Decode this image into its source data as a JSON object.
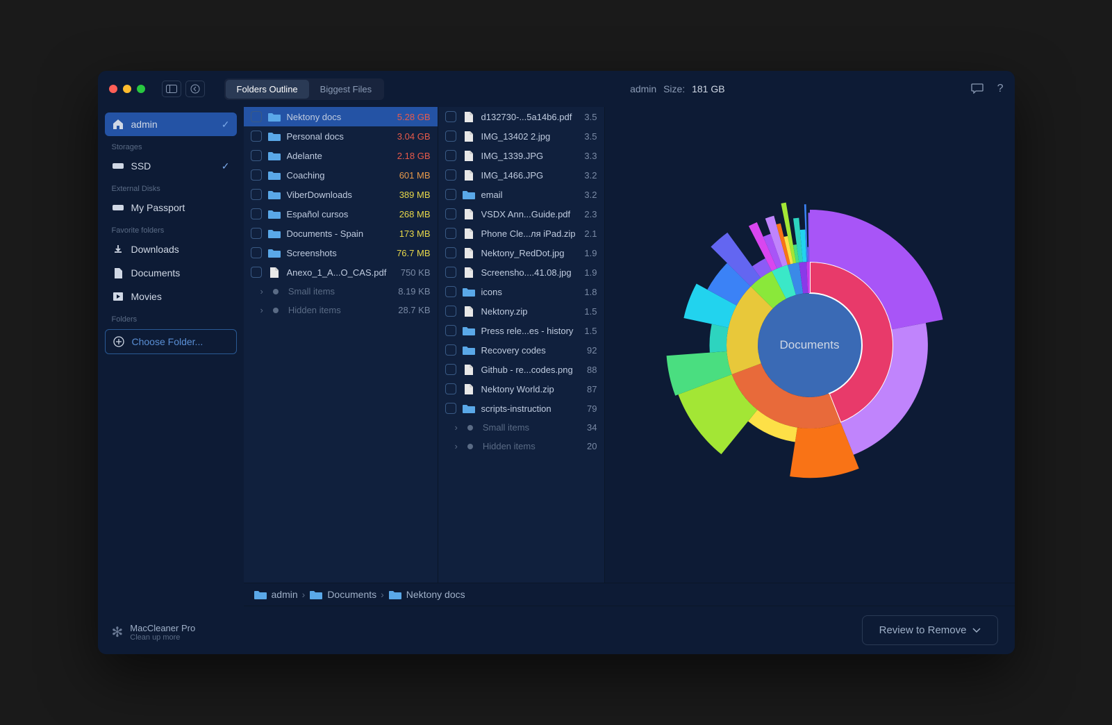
{
  "toolbar": {
    "segments": [
      {
        "label": "Folders Outline",
        "active": true
      },
      {
        "label": "Biggest Files",
        "active": false
      }
    ],
    "title_user": "admin",
    "title_size_label": "Size:",
    "title_size_value": "181 GB"
  },
  "sidebar": {
    "user": {
      "label": "admin",
      "selected": true,
      "checked": true
    },
    "sections": {
      "storages_label": "Storages",
      "storages": [
        {
          "label": "SSD",
          "checked": true
        }
      ],
      "external_label": "External Disks",
      "external": [
        {
          "label": "My Passport"
        }
      ],
      "favorites_label": "Favorite folders",
      "favorites": [
        {
          "label": "Downloads",
          "icon": "download"
        },
        {
          "label": "Documents",
          "icon": "doc"
        },
        {
          "label": "Movies",
          "icon": "movie"
        }
      ],
      "folders_label": "Folders",
      "choose_label": "Choose Folder..."
    },
    "footer": {
      "title": "MacCleaner Pro",
      "sub": "Clean up more"
    }
  },
  "column1": [
    {
      "name": "Nektony docs",
      "size": "5.28 GB",
      "sizeClass": "size-red",
      "type": "folder",
      "selected": true
    },
    {
      "name": "Personal docs",
      "size": "3.04 GB",
      "sizeClass": "size-red",
      "type": "folder"
    },
    {
      "name": "Adelante",
      "size": "2.18 GB",
      "sizeClass": "size-red",
      "type": "folder"
    },
    {
      "name": "Coaching",
      "size": "601 MB",
      "sizeClass": "size-orange",
      "type": "folder"
    },
    {
      "name": "ViberDownloads",
      "size": "389 MB",
      "sizeClass": "size-yellow",
      "type": "folder"
    },
    {
      "name": "Español cursos",
      "size": "268 MB",
      "sizeClass": "size-yellow",
      "type": "folder"
    },
    {
      "name": "Documents - Spain",
      "size": "173 MB",
      "sizeClass": "size-yellow",
      "type": "folder"
    },
    {
      "name": "Screenshots",
      "size": "76.7 MB",
      "sizeClass": "size-yellow",
      "type": "folder"
    },
    {
      "name": "Anexo_1_A...O_CAS.pdf",
      "size": "750 KB",
      "sizeClass": "size-gray",
      "type": "file"
    }
  ],
  "column1_sub": [
    {
      "name": "Small items",
      "size": "8.19 KB"
    },
    {
      "name": "Hidden items",
      "size": "28.7 KB"
    }
  ],
  "column2": [
    {
      "name": "d132730-...5a14b6.pdf",
      "size": "3.5",
      "type": "file"
    },
    {
      "name": "IMG_13402 2.jpg",
      "size": "3.5",
      "type": "file"
    },
    {
      "name": "IMG_1339.JPG",
      "size": "3.3",
      "type": "file"
    },
    {
      "name": "IMG_1466.JPG",
      "size": "3.2",
      "type": "file"
    },
    {
      "name": "email",
      "size": "3.2",
      "type": "folder"
    },
    {
      "name": "VSDX Ann...Guide.pdf",
      "size": "2.3",
      "type": "file"
    },
    {
      "name": "Phone Cle...ля iPad.zip",
      "size": "2.1",
      "type": "file"
    },
    {
      "name": "Nektony_RedDot.jpg",
      "size": "1.9",
      "type": "file"
    },
    {
      "name": "Screensho....41.08.jpg",
      "size": "1.9",
      "type": "file"
    },
    {
      "name": "icons",
      "size": "1.8",
      "type": "folder"
    },
    {
      "name": "Nektony.zip",
      "size": "1.5",
      "type": "file"
    },
    {
      "name": "Press rele...es - history",
      "size": "1.5",
      "type": "folder"
    },
    {
      "name": "Recovery codes",
      "size": "92",
      "type": "folder"
    },
    {
      "name": "Github - re...codes.png",
      "size": "88",
      "type": "file"
    },
    {
      "name": "Nektony World.zip",
      "size": "87",
      "type": "file"
    },
    {
      "name": "scripts-instruction",
      "size": "79",
      "type": "folder"
    }
  ],
  "column2_sub": [
    {
      "name": "Small items",
      "size": "34"
    },
    {
      "name": "Hidden items",
      "size": "20"
    }
  ],
  "breadcrumb": [
    {
      "label": "admin"
    },
    {
      "label": "Documents"
    },
    {
      "label": "Nektony docs"
    }
  ],
  "chart_label": "Documents",
  "chart_data": {
    "type": "sunburst",
    "center_label": "Documents",
    "note": "Approximate arc angles read from image; outer ring shows subfolder distribution",
    "inner_ring": [
      {
        "name": "Nektony docs",
        "value": 5.28,
        "color": "#e83a6a"
      },
      {
        "name": "Personal docs",
        "value": 3.04,
        "color": "#e86a3a"
      },
      {
        "name": "Adelante",
        "value": 2.18,
        "color": "#e8c83a"
      },
      {
        "name": "Coaching",
        "value": 0.601,
        "color": "#8ae83a"
      },
      {
        "name": "ViberDownloads",
        "value": 0.389,
        "color": "#3ae8c8"
      },
      {
        "name": "Español cursos",
        "value": 0.268,
        "color": "#3a8ae8"
      },
      {
        "name": "Documents - Spain",
        "value": 0.173,
        "color": "#8a3ae8"
      },
      {
        "name": "Screenshots",
        "value": 0.0767,
        "color": "#c83ae8"
      }
    ]
  },
  "review_btn": "Review to Remove"
}
